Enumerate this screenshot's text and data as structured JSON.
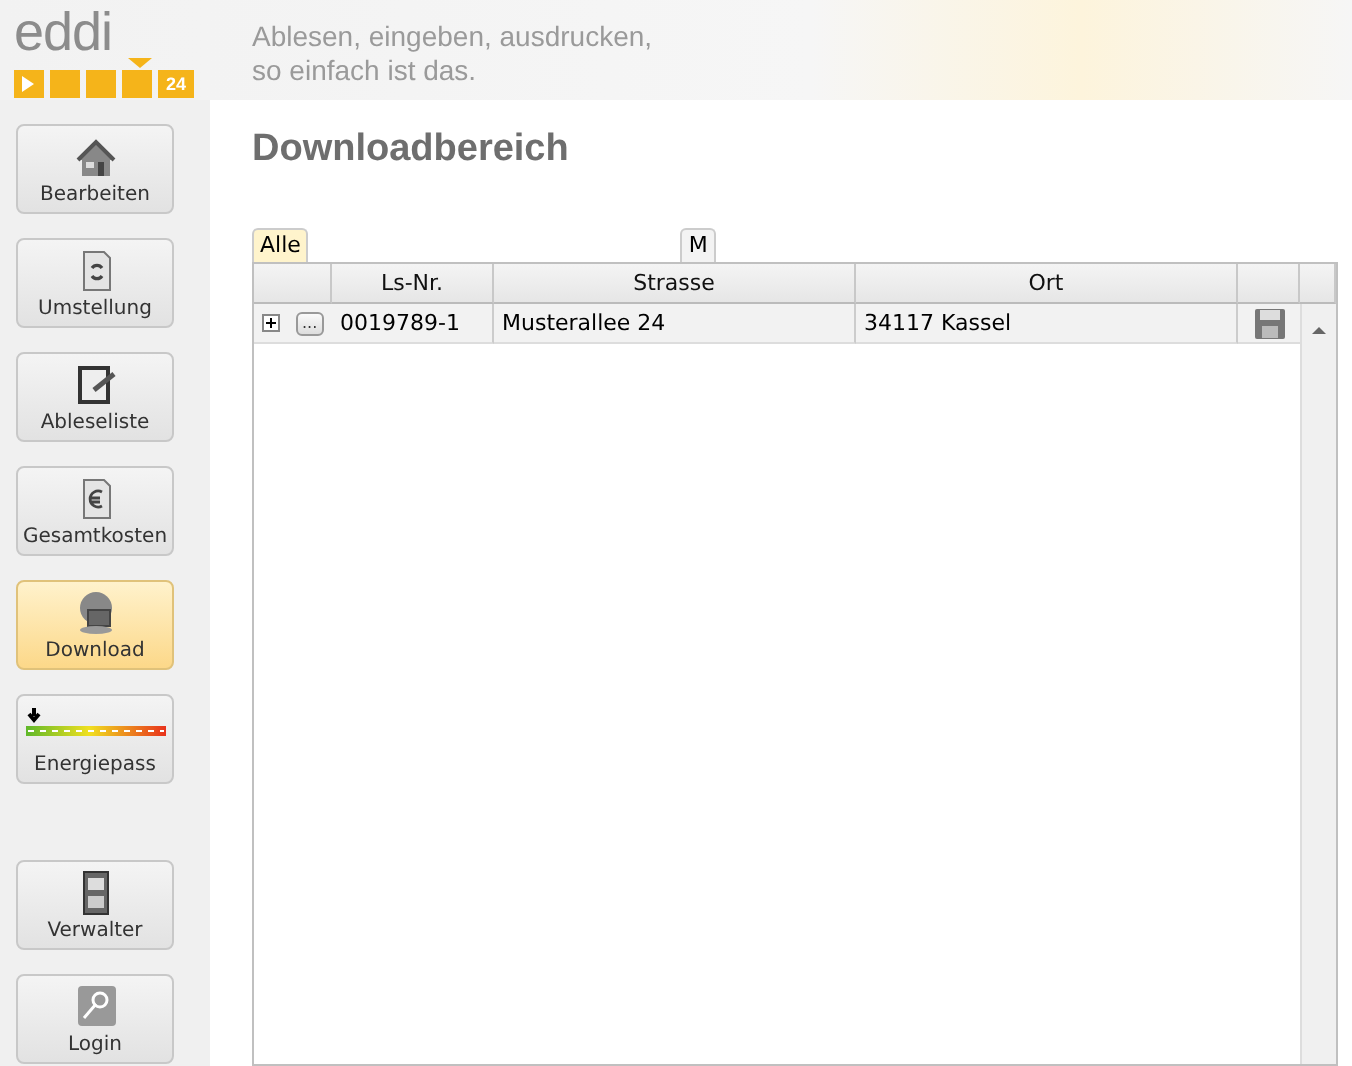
{
  "header": {
    "logo": {
      "wordmark": "eddi",
      "badge": "24"
    },
    "tagline": [
      "Ablesen, eingeben, ausdrucken,",
      "so einfach ist das."
    ]
  },
  "nav_groups": [
    [
      {
        "label": "Bearbeiten",
        "selected": false
      },
      {
        "label": "Umstellung",
        "selected": false
      },
      {
        "label": "Ableseliste",
        "selected": false
      },
      {
        "label": "Gesamtkosten",
        "selected": false
      },
      {
        "label": "Download",
        "selected": true
      },
      {
        "label": "Energiepass",
        "selected": false
      }
    ],
    [
      {
        "label": "Verwalter",
        "selected": false
      },
      {
        "label": "Login",
        "selected": false
      }
    ]
  ],
  "page_title": "Downloadbereich",
  "filter_tabs": [
    {
      "label": "Alle",
      "selected": true
    },
    {
      "label": "M",
      "selected": false
    }
  ],
  "table": {
    "columns": [
      "Ls-Nr.",
      "Strasse",
      "Ort"
    ],
    "rows": [
      {
        "expanded": false,
        "more": "...",
        "cells": [
          "0019789-1",
          "Musterallee 24",
          "34117 Kassel"
        ]
      }
    ]
  }
}
